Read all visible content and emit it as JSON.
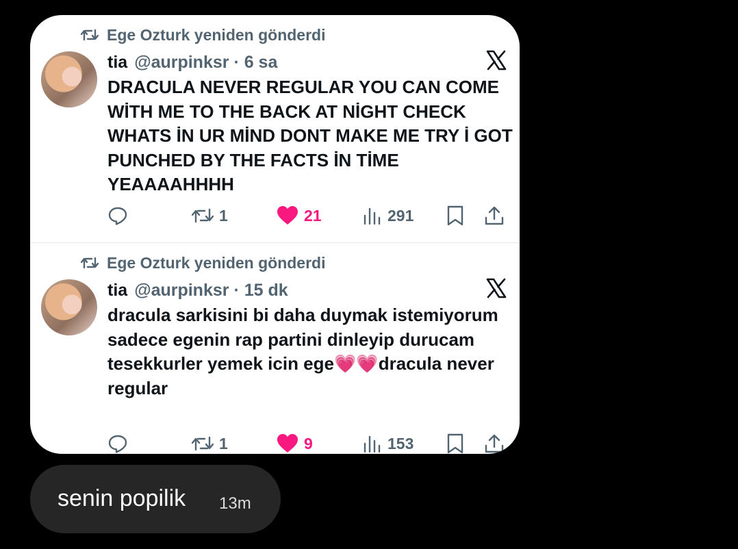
{
  "tweets": [
    {
      "retweet_label": "Ege Ozturk yeniden gönderdi",
      "name": "tia",
      "handle": "@aurpinksr · 6 sa",
      "text": "DRACULA NEVER REGULAR YOU CAN COME WİTH ME TO THE BACK AT NİGHT CHECK WHATS İN UR MİND DONT MAKE ME TRY İ GOT PUNCHED BY THE FACTS İN TİME YEAAAAHHHH",
      "retweets": "1",
      "likes": "21",
      "views": "291"
    },
    {
      "retweet_label": "Ege Ozturk yeniden gönderdi",
      "name": "tia",
      "handle": "@aurpinksr · 15 dk",
      "text": "dracula sarkisini bi daha duymak istemiyorum sadece egenin rap partini dinleyip durucam tesekkurler yemek icin ege💗💗dracula never regular",
      "retweets": "1",
      "likes": "9",
      "views": "153"
    }
  ],
  "message": {
    "text": "senin popilik",
    "time": "13m"
  },
  "colors": {
    "like": "#f91880",
    "muted": "#536471",
    "background": "#000000",
    "bubble": "#262626"
  },
  "icons": [
    "retweet-icon",
    "x-logo-icon",
    "reply-icon",
    "heart-icon",
    "views-icon",
    "bookmark-icon",
    "share-icon"
  ]
}
